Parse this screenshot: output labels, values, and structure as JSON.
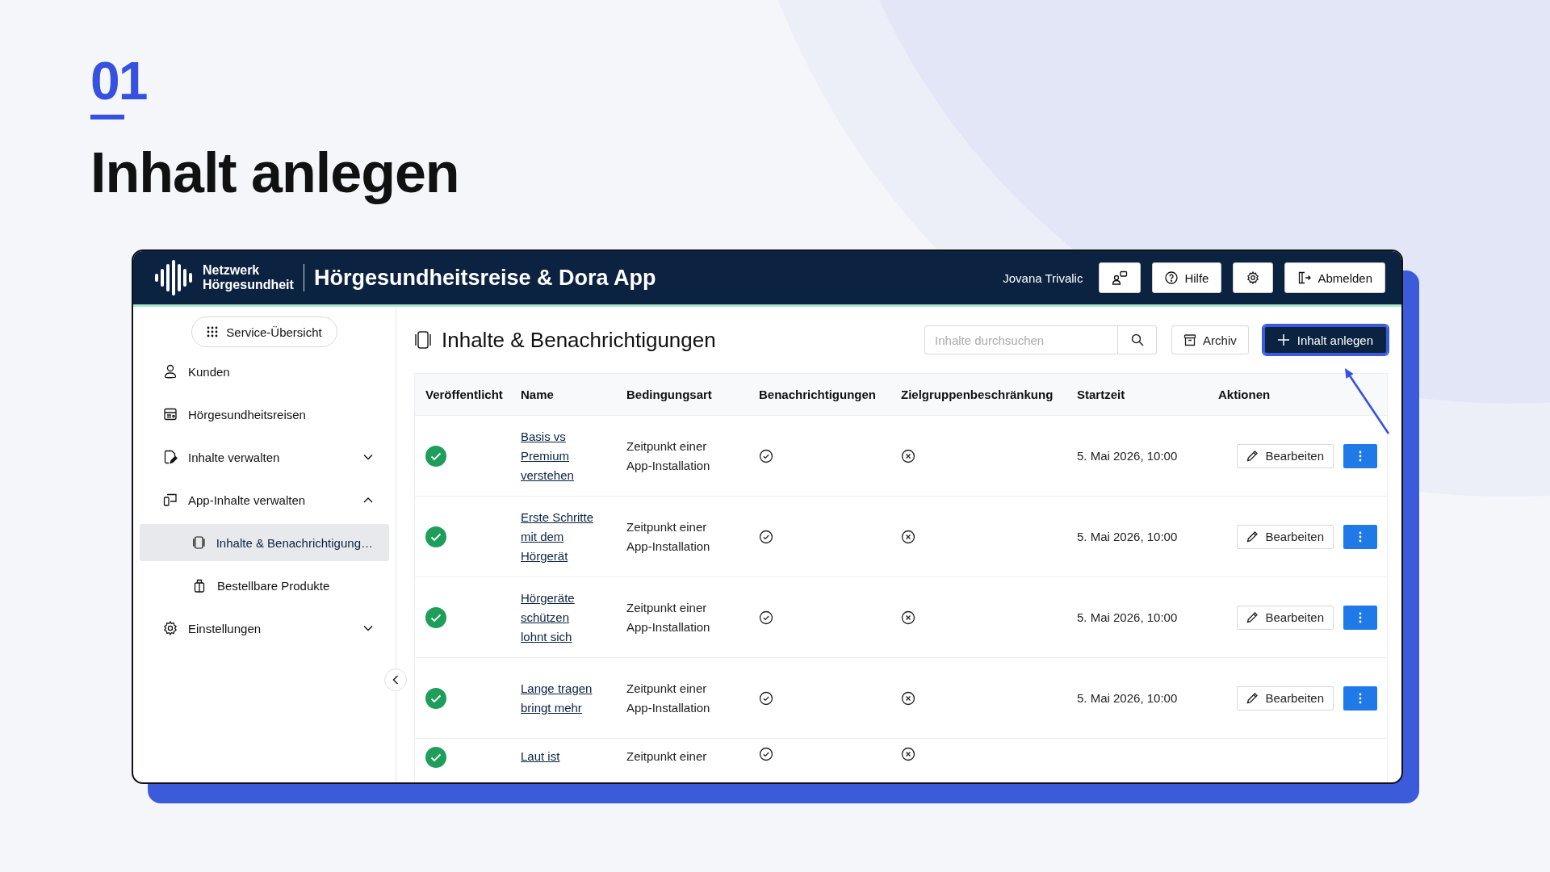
{
  "slide": {
    "number": "01",
    "title": "Inhalt anlegen"
  },
  "header": {
    "brand_lines": [
      "Netzwerk",
      "Hörgesundheit"
    ],
    "app_title": "Hörgesundheitsreise & Dora App",
    "user": "Jovana Trivalic",
    "buttons": [
      {
        "kind": "feedback"
      },
      {
        "kind": "help",
        "label": "Hilfe"
      },
      {
        "kind": "settings"
      },
      {
        "kind": "logout",
        "label": "Abmelden"
      }
    ]
  },
  "sidebar": {
    "service_button": "Service-Übersicht",
    "items": [
      {
        "label": "Kunden",
        "kind": "person",
        "selected": false
      },
      {
        "label": "Hörgesundheitsreisen",
        "kind": "journey",
        "selected": false
      },
      {
        "label": "Inhalte verwalten",
        "kind": "document",
        "selected": false,
        "expanded": false
      },
      {
        "label": "App-Inhalte verwalten",
        "kind": "devices",
        "selected": false,
        "expanded": true,
        "children": [
          {
            "label": "Inhalte & Benachrichtigung…",
            "kind": "phone",
            "selected": true
          },
          {
            "label": "Bestellbare Produkte",
            "kind": "bag",
            "selected": false
          }
        ]
      },
      {
        "label": "Einstellungen",
        "kind": "gear",
        "selected": false,
        "expanded": false
      }
    ]
  },
  "content": {
    "title": "Inhalte & Benachrichtigungen",
    "search": {
      "placeholder": "Inhalte durchsuchen"
    },
    "archive_button": "Archiv",
    "create_button": "Inhalt anlegen",
    "table": {
      "columns": [
        "Veröffentlicht",
        "Name",
        "Bedingungsart",
        "Benachrichtigungen",
        "Zielgruppenbeschränkung",
        "Startzeit",
        "Aktionen"
      ],
      "rows": [
        {
          "published": true,
          "name": "Basis vs Premium verstehen",
          "condition": "Zeitpunkt einer App-Installation",
          "notifications": true,
          "target_restriction": false,
          "start": "5. Mai 2026, 10:00",
          "edit": "Bearbeiten"
        },
        {
          "published": true,
          "name": "Erste Schritte mit dem Hörgerät",
          "condition": "Zeitpunkt einer App-Installation",
          "notifications": true,
          "target_restriction": false,
          "start": "5. Mai 2026, 10:00",
          "edit": "Bearbeiten"
        },
        {
          "published": true,
          "name": "Hörgeräte schützen lohnt sich",
          "condition": "Zeitpunkt einer App-Installation",
          "notifications": true,
          "target_restriction": false,
          "start": "5. Mai 2026, 10:00",
          "edit": "Bearbeiten"
        },
        {
          "published": true,
          "name": "Lange tragen bringt mehr",
          "condition": "Zeitpunkt einer App-Installation",
          "notifications": true,
          "target_restriction": false,
          "start": "5. Mai 2026, 10:00",
          "edit": "Bearbeiten"
        },
        {
          "published": true,
          "name": "Laut ist",
          "condition": "Zeitpunkt einer",
          "notifications": true,
          "target_restriction": false
        }
      ]
    }
  }
}
